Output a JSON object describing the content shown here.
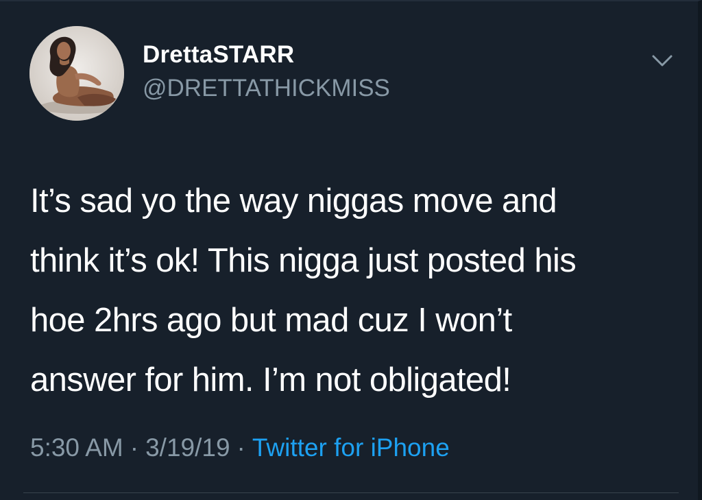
{
  "tweet": {
    "author": {
      "display_name": "DrettaSTARR",
      "handle": "@DRETTATHICKMISS"
    },
    "text_lines": [
      "It’s sad yo the way niggas move and",
      "think it’s ok! This nigga just posted his",
      "hoe 2hrs ago but mad cuz I won’t",
      "answer for him. I’m not obligated!"
    ],
    "time": "5:30 AM",
    "separator": "·",
    "date": "3/19/19",
    "source": "Twitter for iPhone"
  },
  "icons": {
    "menu": "chevron-down-icon",
    "avatar": "profile-photo"
  },
  "colors": {
    "background": "#17202b",
    "primary_text": "#ffffff",
    "secondary_text": "#8899a6",
    "link": "#1da1f2",
    "divider": "#38444d"
  }
}
